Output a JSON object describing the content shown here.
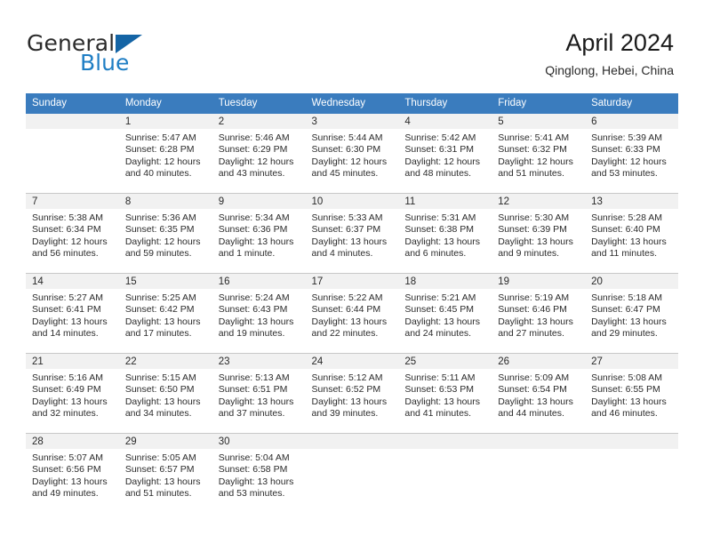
{
  "brand": {
    "word_general": "General",
    "word_blue": "Blue",
    "logo_icon": "triangle-logo-icon"
  },
  "header": {
    "title": "April 2024",
    "subtitle": "Qinglong, Hebei, China"
  },
  "theme": {
    "header_row_bg": "#3a7cbe",
    "daynum_band_bg": "#f1f1f1",
    "grid_line": "#c8c8c8",
    "brand_blue": "#1f7ec4",
    "brand_dark": "#2b2b2b",
    "text": "#2b2b2b"
  },
  "labels": {
    "sunrise_prefix": "Sunrise:",
    "sunset_prefix": "Sunset:",
    "daylight_prefix": "Daylight:"
  },
  "weekdays": [
    "Sunday",
    "Monday",
    "Tuesday",
    "Wednesday",
    "Thursday",
    "Friday",
    "Saturday"
  ],
  "weeks": [
    [
      {
        "day": "",
        "sunrise": "",
        "sunset": "",
        "daylight": "",
        "empty": true
      },
      {
        "day": "1",
        "sunrise": "Sunrise: 5:47 AM",
        "sunset": "Sunset: 6:28 PM",
        "daylight": "Daylight: 12 hours and 40 minutes."
      },
      {
        "day": "2",
        "sunrise": "Sunrise: 5:46 AM",
        "sunset": "Sunset: 6:29 PM",
        "daylight": "Daylight: 12 hours and 43 minutes."
      },
      {
        "day": "3",
        "sunrise": "Sunrise: 5:44 AM",
        "sunset": "Sunset: 6:30 PM",
        "daylight": "Daylight: 12 hours and 45 minutes."
      },
      {
        "day": "4",
        "sunrise": "Sunrise: 5:42 AM",
        "sunset": "Sunset: 6:31 PM",
        "daylight": "Daylight: 12 hours and 48 minutes."
      },
      {
        "day": "5",
        "sunrise": "Sunrise: 5:41 AM",
        "sunset": "Sunset: 6:32 PM",
        "daylight": "Daylight: 12 hours and 51 minutes."
      },
      {
        "day": "6",
        "sunrise": "Sunrise: 5:39 AM",
        "sunset": "Sunset: 6:33 PM",
        "daylight": "Daylight: 12 hours and 53 minutes."
      }
    ],
    [
      {
        "day": "7",
        "sunrise": "Sunrise: 5:38 AM",
        "sunset": "Sunset: 6:34 PM",
        "daylight": "Daylight: 12 hours and 56 minutes."
      },
      {
        "day": "8",
        "sunrise": "Sunrise: 5:36 AM",
        "sunset": "Sunset: 6:35 PM",
        "daylight": "Daylight: 12 hours and 59 minutes."
      },
      {
        "day": "9",
        "sunrise": "Sunrise: 5:34 AM",
        "sunset": "Sunset: 6:36 PM",
        "daylight": "Daylight: 13 hours and 1 minute."
      },
      {
        "day": "10",
        "sunrise": "Sunrise: 5:33 AM",
        "sunset": "Sunset: 6:37 PM",
        "daylight": "Daylight: 13 hours and 4 minutes."
      },
      {
        "day": "11",
        "sunrise": "Sunrise: 5:31 AM",
        "sunset": "Sunset: 6:38 PM",
        "daylight": "Daylight: 13 hours and 6 minutes."
      },
      {
        "day": "12",
        "sunrise": "Sunrise: 5:30 AM",
        "sunset": "Sunset: 6:39 PM",
        "daylight": "Daylight: 13 hours and 9 minutes."
      },
      {
        "day": "13",
        "sunrise": "Sunrise: 5:28 AM",
        "sunset": "Sunset: 6:40 PM",
        "daylight": "Daylight: 13 hours and 11 minutes."
      }
    ],
    [
      {
        "day": "14",
        "sunrise": "Sunrise: 5:27 AM",
        "sunset": "Sunset: 6:41 PM",
        "daylight": "Daylight: 13 hours and 14 minutes."
      },
      {
        "day": "15",
        "sunrise": "Sunrise: 5:25 AM",
        "sunset": "Sunset: 6:42 PM",
        "daylight": "Daylight: 13 hours and 17 minutes."
      },
      {
        "day": "16",
        "sunrise": "Sunrise: 5:24 AM",
        "sunset": "Sunset: 6:43 PM",
        "daylight": "Daylight: 13 hours and 19 minutes."
      },
      {
        "day": "17",
        "sunrise": "Sunrise: 5:22 AM",
        "sunset": "Sunset: 6:44 PM",
        "daylight": "Daylight: 13 hours and 22 minutes."
      },
      {
        "day": "18",
        "sunrise": "Sunrise: 5:21 AM",
        "sunset": "Sunset: 6:45 PM",
        "daylight": "Daylight: 13 hours and 24 minutes."
      },
      {
        "day": "19",
        "sunrise": "Sunrise: 5:19 AM",
        "sunset": "Sunset: 6:46 PM",
        "daylight": "Daylight: 13 hours and 27 minutes."
      },
      {
        "day": "20",
        "sunrise": "Sunrise: 5:18 AM",
        "sunset": "Sunset: 6:47 PM",
        "daylight": "Daylight: 13 hours and 29 minutes."
      }
    ],
    [
      {
        "day": "21",
        "sunrise": "Sunrise: 5:16 AM",
        "sunset": "Sunset: 6:49 PM",
        "daylight": "Daylight: 13 hours and 32 minutes."
      },
      {
        "day": "22",
        "sunrise": "Sunrise: 5:15 AM",
        "sunset": "Sunset: 6:50 PM",
        "daylight": "Daylight: 13 hours and 34 minutes."
      },
      {
        "day": "23",
        "sunrise": "Sunrise: 5:13 AM",
        "sunset": "Sunset: 6:51 PM",
        "daylight": "Daylight: 13 hours and 37 minutes."
      },
      {
        "day": "24",
        "sunrise": "Sunrise: 5:12 AM",
        "sunset": "Sunset: 6:52 PM",
        "daylight": "Daylight: 13 hours and 39 minutes."
      },
      {
        "day": "25",
        "sunrise": "Sunrise: 5:11 AM",
        "sunset": "Sunset: 6:53 PM",
        "daylight": "Daylight: 13 hours and 41 minutes."
      },
      {
        "day": "26",
        "sunrise": "Sunrise: 5:09 AM",
        "sunset": "Sunset: 6:54 PM",
        "daylight": "Daylight: 13 hours and 44 minutes."
      },
      {
        "day": "27",
        "sunrise": "Sunrise: 5:08 AM",
        "sunset": "Sunset: 6:55 PM",
        "daylight": "Daylight: 13 hours and 46 minutes."
      }
    ],
    [
      {
        "day": "28",
        "sunrise": "Sunrise: 5:07 AM",
        "sunset": "Sunset: 6:56 PM",
        "daylight": "Daylight: 13 hours and 49 minutes."
      },
      {
        "day": "29",
        "sunrise": "Sunrise: 5:05 AM",
        "sunset": "Sunset: 6:57 PM",
        "daylight": "Daylight: 13 hours and 51 minutes."
      },
      {
        "day": "30",
        "sunrise": "Sunrise: 5:04 AM",
        "sunset": "Sunset: 6:58 PM",
        "daylight": "Daylight: 13 hours and 53 minutes."
      },
      {
        "day": "",
        "sunrise": "",
        "sunset": "",
        "daylight": "",
        "empty": true
      },
      {
        "day": "",
        "sunrise": "",
        "sunset": "",
        "daylight": "",
        "empty": true
      },
      {
        "day": "",
        "sunrise": "",
        "sunset": "",
        "daylight": "",
        "empty": true
      },
      {
        "day": "",
        "sunrise": "",
        "sunset": "",
        "daylight": "",
        "empty": true
      }
    ]
  ]
}
